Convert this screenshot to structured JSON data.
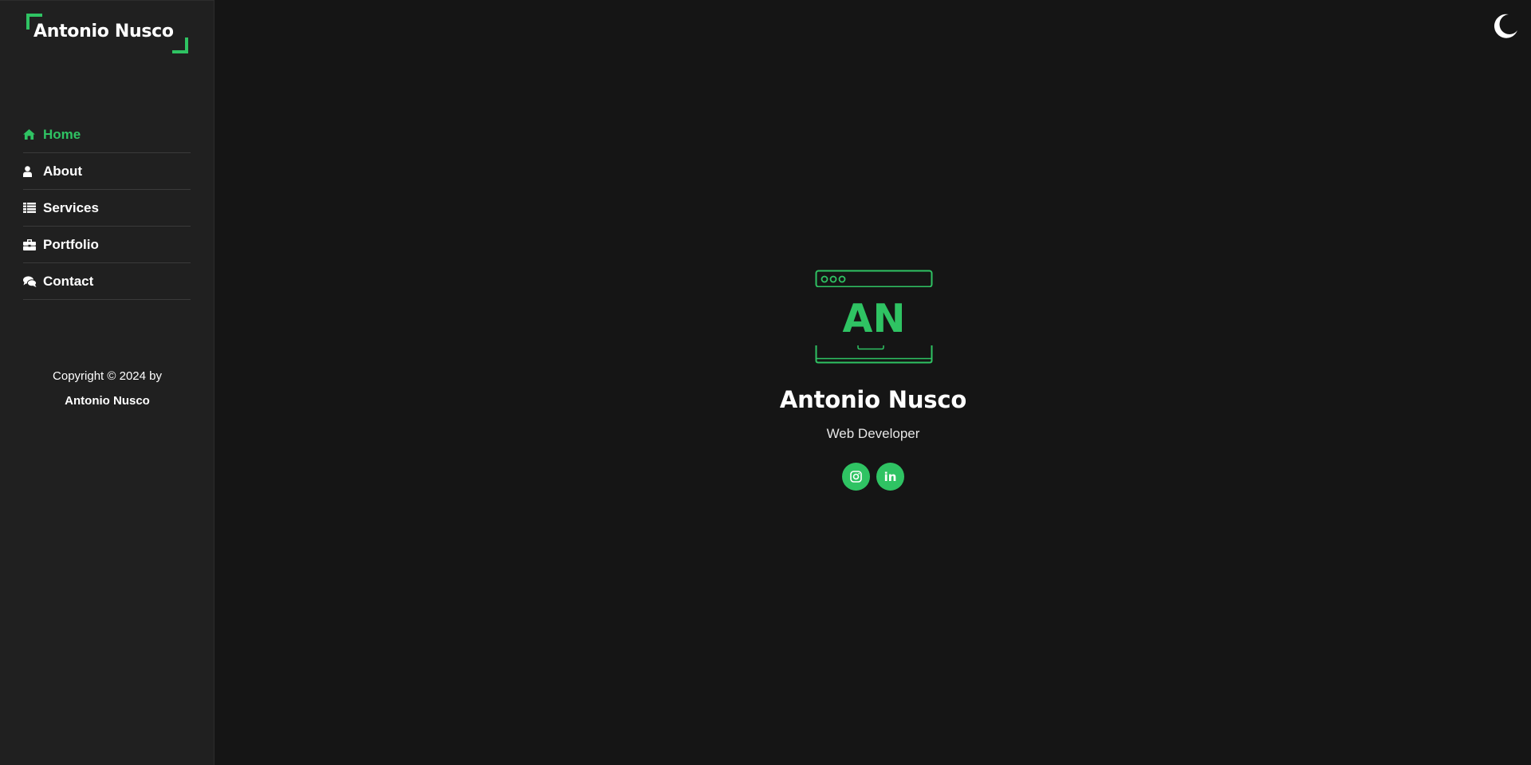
{
  "colors": {
    "accent": "#2fc363",
    "background": "#151515",
    "sidebar": "#202020",
    "text": "#ffffff"
  },
  "sidebar": {
    "logo_text": "Antonio Nusco",
    "nav": [
      {
        "label": "Home",
        "icon": "home-icon",
        "active": true
      },
      {
        "label": "About",
        "icon": "user-icon",
        "active": false
      },
      {
        "label": "Services",
        "icon": "list-icon",
        "active": false
      },
      {
        "label": "Portfolio",
        "icon": "briefcase-icon",
        "active": false
      },
      {
        "label": "Contact",
        "icon": "comments-icon",
        "active": false
      }
    ],
    "copyright_line": "Copyright © 2024 by",
    "copyright_author": "Antonio Nusco"
  },
  "header": {
    "theme_toggle_icon": "moon-icon"
  },
  "hero": {
    "monogram": "AN",
    "name": "Antonio Nusco",
    "role": "Web Developer",
    "socials": [
      {
        "name": "instagram",
        "icon": "instagram-icon"
      },
      {
        "name": "linkedin",
        "icon": "linkedin-icon",
        "label": "in"
      }
    ]
  }
}
